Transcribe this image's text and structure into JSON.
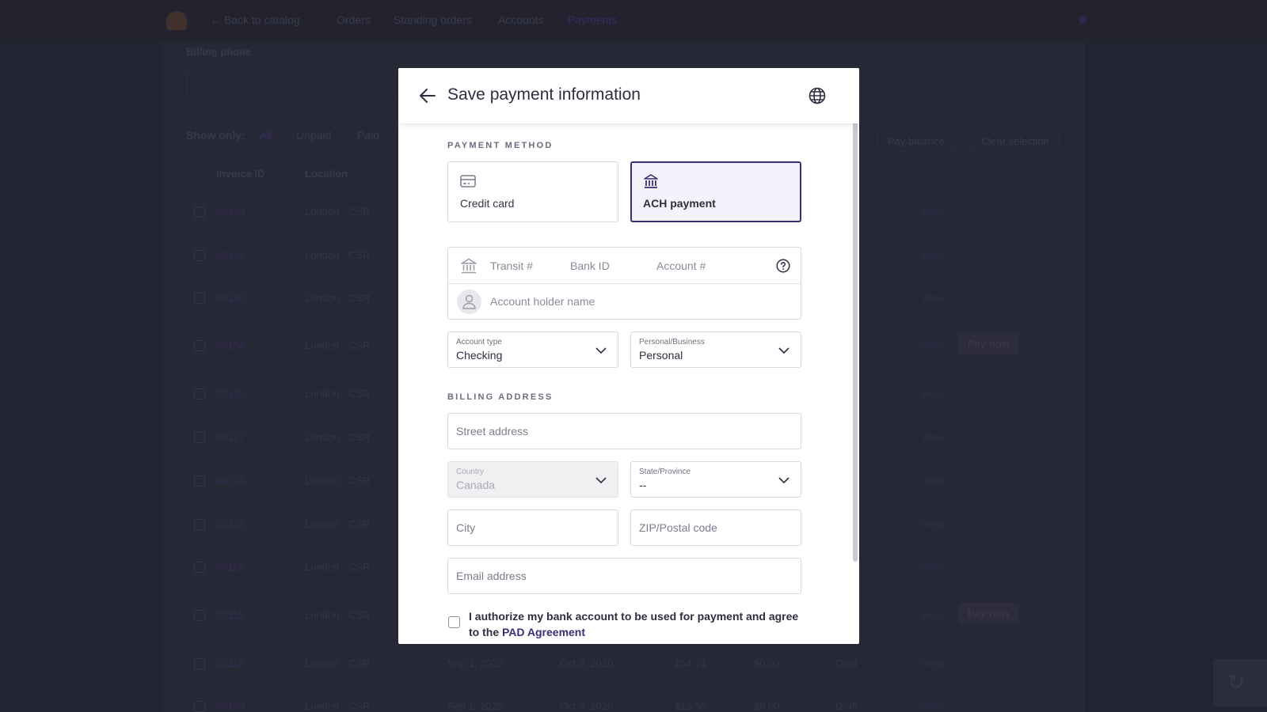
{
  "background": {
    "nav": {
      "back": "← Back to catalog",
      "items": [
        "Orders",
        "Standing orders",
        "Accounts",
        "Payments"
      ],
      "active_item": "Payments"
    },
    "billing_phone_label": "Billing phone",
    "filters": {
      "label": "Show only:",
      "options": [
        "All",
        "Unpaid",
        "Paid"
      ]
    },
    "actions": [
      "Pay balance",
      "Clear selection"
    ],
    "columns": [
      "Invoice ID",
      "Location"
    ],
    "rows": [
      {
        "id": "#0143",
        "location": "London - CSR"
      },
      {
        "id": "#0141",
        "location": "London - CSR"
      },
      {
        "id": "#0136",
        "location": "London - CSR"
      },
      {
        "id": "#0134",
        "location": "London - CSR",
        "pay": "Pay now"
      },
      {
        "id": "#0130",
        "location": "London - CSR"
      },
      {
        "id": "#0127",
        "location": "London - CSR"
      },
      {
        "id": "#0124",
        "location": "London - CSR"
      },
      {
        "id": "#0121",
        "location": "London - CSR"
      },
      {
        "id": "#0118",
        "location": "London - CSR"
      },
      {
        "id": "#0115",
        "location": "London - CSR",
        "pay": "Pay now"
      },
      {
        "id": "#0112",
        "location": "London - CSR",
        "issued": "Sep 1, 2020",
        "due": "Oct 3, 2020",
        "amount": "$54.74",
        "paid": "$0.00",
        "status": "Draft"
      },
      {
        "id": "#0109",
        "location": "London - CSR",
        "issued": "Sep 1, 2020",
        "due": "Oct 3, 2020",
        "amount": "$13.58",
        "paid": "$0.00",
        "status": "Draft"
      }
    ],
    "view_label": "View"
  },
  "modal": {
    "title": "Save payment information",
    "payment_method": {
      "section_label": "PAYMENT METHOD",
      "options": [
        {
          "label": "Credit card",
          "icon": "credit-card-icon",
          "selected": false
        },
        {
          "label": "ACH payment",
          "icon": "bank-icon",
          "selected": true
        }
      ]
    },
    "bank_fields": {
      "transit_placeholder": "Transit #",
      "bank_id_placeholder": "Bank ID",
      "account_placeholder": "Account #",
      "holder_placeholder": "Account holder name"
    },
    "account_type": {
      "label": "Account type",
      "value": "Checking"
    },
    "personal_business": {
      "label": "Personal/Business",
      "value": "Personal"
    },
    "billing_address": {
      "section_label": "BILLING ADDRESS",
      "street_placeholder": "Street address",
      "country": {
        "label": "Country",
        "value": "Canada",
        "disabled": true
      },
      "state": {
        "label": "State/Province",
        "value": "--"
      },
      "city_placeholder": "City",
      "zip_placeholder": "ZIP/Postal code",
      "email_placeholder": "Email address"
    },
    "authorization": {
      "text": "I authorize my bank account to be used for payment and agree to the ",
      "link": "PAD Agreement",
      "checked": false
    }
  },
  "colors": {
    "accent": "#3b2e77",
    "overlay": "#2b2c3b",
    "text": "#2d2e41"
  }
}
